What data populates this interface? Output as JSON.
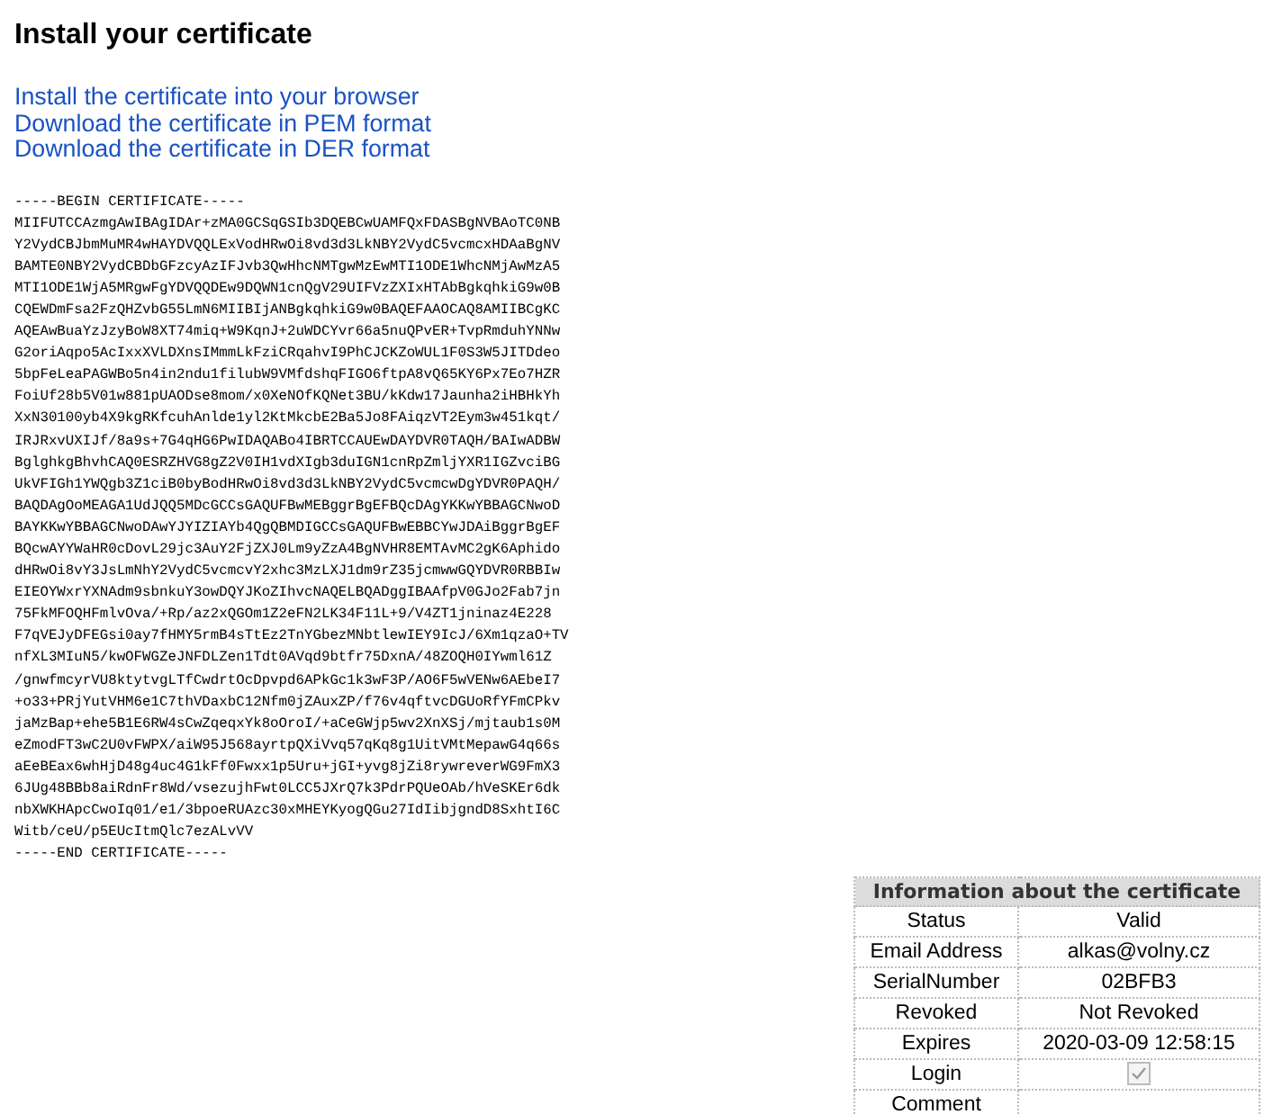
{
  "heading": "Install your certificate",
  "links": [
    "Install the certificate into your browser",
    "Download the certificate in PEM format",
    "Download the certificate in DER format"
  ],
  "certificate": [
    "-----BEGIN CERTIFICATE-----",
    "MIIFUTCCAzmgAwIBAgIDAr+zMA0GCSqGSIb3DQEBCwUAMFQxFDASBgNVBAoTC0NB",
    "Y2VydCBJbmMuMR4wHAYDVQQLExVodHRwOi8vd3d3LkNBY2VydC5vcmcxHDAaBgNV",
    "BAMTE0NBY2VydCBDbGFzcyAzIFJvb3QwHhcNMTgwMzEwMTI1ODE1WhcNMjAwMzA5",
    "MTI1ODE1WjA5MRgwFgYDVQQDEw9DQWN1cnQgV29UIFVzZXIxHTAbBgkqhkiG9w0B",
    "CQEWDmFsa2FzQHZvbG55LmN6MIIBIjANBgkqhkiG9w0BAQEFAAOCAQ8AMIIBCgKC",
    "AQEAwBuaYzJzyBoW8XT74miq+W9KqnJ+2uWDCYvr66a5nuQPvER+TvpRmduhYNNw",
    "G2oriAqpo5AcIxxXVLDXnsIMmmLkFziCRqahvI9PhCJCKZoWUL1F0S3W5JITDdeo",
    "5bpFeLeaPAGWBo5n4in2ndu1filubW9VMfdshqFIGO6ftpA8vQ65KY6Px7Eo7HZR",
    "FoiUf28b5V01w881pUAODse8mom/x0XeNOfKQNet3BU/kKdw17Jaunha2iHBHkYh",
    "XxN30100yb4X9kgRKfcuhAnlde1yl2KtMkcbE2Ba5Jo8FAiqzVT2Eym3w451kqt/",
    "IRJRxvUXIJf/8a9s+7G4qHG6PwIDAQABo4IBRTCCAUEwDAYDVR0TAQH/BAIwADBW",
    "BglghkgBhvhCAQ0ESRZHVG8gZ2V0IH1vdXIgb3duIGN1cnRpZmljYXR1IGZvciBG",
    "UkVFIGh1YWQgb3Z1ciB0byBodHRwOi8vd3d3LkNBY2VydC5vcmcwDgYDVR0PAQH/",
    "BAQDAgOoMEAGA1UdJQQ5MDcGCCsGAQUFBwMEBggrBgEFBQcDAgYKKwYBBAGCNwoD",
    "BAYKKwYBBAGCNwoDAwYJYIZIAYb4QgQBMDIGCCsGAQUFBwEBBCYwJDAiBggrBgEF",
    "BQcwAYYWaHR0cDovL29jc3AuY2FjZXJ0Lm9yZzA4BgNVHR8EMTAvMC2gK6Aphido",
    "dHRwOi8vY3JsLmNhY2VydC5vcmcvY2xhc3MzLXJ1dm9rZ35jcmwwGQYDVR0RBBIw",
    "EIEOYWxrYXNAdm9sbnkuY3owDQYJKoZIhvcNAQELBQADggIBAAfpV0GJo2Fab7jn",
    "75FkMFOQHFmlvOva/+Rp/az2xQGOm1Z2eFN2LK34F11L+9/V4ZT1jninaz4E228",
    "F7qVEJyDFEGsi0ay7fHMY5rmB4sTtEz2TnYGbezMNbtlewIEY9IcJ/6Xm1qzaO+TV",
    "nfXL3MIuN5/kwOFWGZeJNFDLZen1Tdt0AVqd9btfr75DxnA/48ZOQH0IYwml61Z",
    "/gnwfmcyrVU8ktytvgLTfCwdrtOcDpvpd6APkGc1k3wF3P/AO6F5wVENw6AEbeI7",
    "+o33+PRjYutVHM6e1C7thVDaxbC12Nfm0jZAuxZP/f76v4qftvcDGUoRfYFmCPkv",
    "jaMzBap+ehe5B1E6RW4sCwZqeqxYk8oOroI/+aCeGWjp5wv2XnXSj/mjtaub1s0M",
    "eZmodFT3wC2U0vFWPX/aiW95J568ayrtpQXiVvq57qKq8g1UitVMtMepawG4q66s",
    "aEeBEax6whHjD48g4uc4G1kFf0Fwxx1p5Uru+jGI+yvg8jZi8rywreverWG9FmX3",
    "6JUg48BBb8aiRdnFr8Wd/vsezujhFwt0LCC5JXrQ7k3PdrPQUeOAb/hVeSKEr6dk",
    "nbXWKHApcCwoIq01/e1/3bpoeRUAzc30xMHEYKyogQGu27IdIibjgndD8SxhtI6C",
    "Witb/ceU/p5EUcItmQlc7ezALvVV",
    "-----END CERTIFICATE-----"
  ],
  "info": {
    "title": "Information about the certificate",
    "rows": [
      {
        "label": "Status",
        "kind": "text",
        "value": "Valid"
      },
      {
        "label": "Email Address",
        "kind": "text",
        "value": "alkas@volny.cz"
      },
      {
        "label": "SerialNumber",
        "kind": "text",
        "value": "02BFB3"
      },
      {
        "label": "Revoked",
        "kind": "text",
        "value": "Not Revoked"
      },
      {
        "label": "Expires",
        "kind": "text",
        "value": "2020-03-09 12:58:15"
      },
      {
        "label": "Login",
        "kind": "checkbox",
        "checked": true
      },
      {
        "label": "Comment",
        "kind": "empty"
      }
    ]
  }
}
